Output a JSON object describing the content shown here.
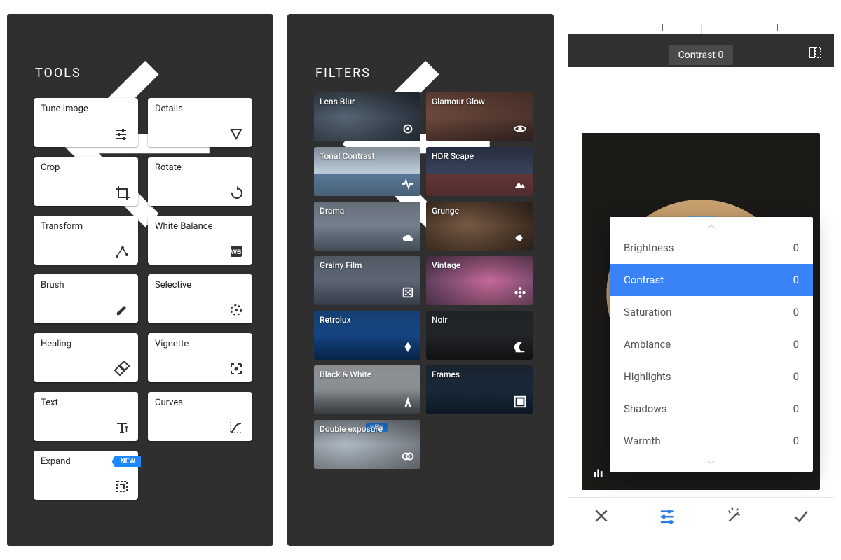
{
  "screen1": {
    "title": "TOOLS",
    "tools": [
      {
        "label": "Tune Image"
      },
      {
        "label": "Details"
      },
      {
        "label": "Crop"
      },
      {
        "label": "Rotate"
      },
      {
        "label": "Transform"
      },
      {
        "label": "White Balance"
      },
      {
        "label": "Brush"
      },
      {
        "label": "Selective"
      },
      {
        "label": "Healing"
      },
      {
        "label": "Vignette"
      },
      {
        "label": "Text"
      },
      {
        "label": "Curves"
      },
      {
        "label": "Expand",
        "badge": "NEW"
      }
    ]
  },
  "screen2": {
    "title": "FILTERS",
    "filters": [
      {
        "label": "Lens Blur"
      },
      {
        "label": "Glamour Glow"
      },
      {
        "label": "Tonal Contrast"
      },
      {
        "label": "HDR Scape"
      },
      {
        "label": "Drama"
      },
      {
        "label": "Grunge"
      },
      {
        "label": "Grainy Film"
      },
      {
        "label": "Vintage"
      },
      {
        "label": "Retrolux"
      },
      {
        "label": "Noir"
      },
      {
        "label": "Black & White"
      },
      {
        "label": "Frames"
      },
      {
        "label": "Double exposure",
        "badge": "NEW"
      }
    ]
  },
  "screen3": {
    "current_adjust_chip": "Contrast 0",
    "adjustments": [
      {
        "name": "Brightness",
        "value": "0",
        "selected": false
      },
      {
        "name": "Contrast",
        "value": "0",
        "selected": true
      },
      {
        "name": "Saturation",
        "value": "0",
        "selected": false
      },
      {
        "name": "Ambiance",
        "value": "0",
        "selected": false
      },
      {
        "name": "Highlights",
        "value": "0",
        "selected": false
      },
      {
        "name": "Shadows",
        "value": "0",
        "selected": false
      },
      {
        "name": "Warmth",
        "value": "0",
        "selected": false
      }
    ]
  }
}
